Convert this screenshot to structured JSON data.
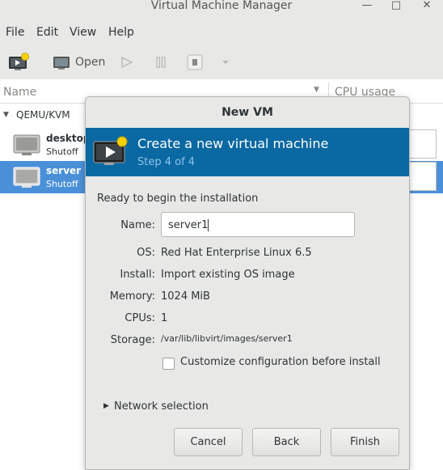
{
  "window": {
    "title": "Virtual Machine Manager",
    "minimize": "—",
    "maximize": "□",
    "close": "✕"
  },
  "menubar": {
    "items": [
      "File",
      "Edit",
      "View",
      "Help"
    ]
  },
  "toolbar": {
    "open_label": "Open"
  },
  "columns": {
    "name": "Name",
    "cpu": "CPU usage"
  },
  "tree": {
    "group": "QEMU/KVM",
    "vms": [
      {
        "name": "desktop",
        "state": "Shutoff"
      },
      {
        "name": "server",
        "state": "Shutoff"
      }
    ]
  },
  "dialog": {
    "title": "New VM",
    "banner_title": "Create a new virtual machine",
    "banner_step": "Step 4 of 4",
    "ready_text": "Ready to begin the installation",
    "fields": {
      "name_label": "Name:",
      "name_value": "server1",
      "os_label": "OS:",
      "os_value": "Red Hat Enterprise Linux 6.5",
      "install_label": "Install:",
      "install_value": "Import existing OS image",
      "memory_label": "Memory:",
      "memory_value": "1024 MiB",
      "cpus_label": "CPUs:",
      "cpus_value": "1",
      "storage_label": "Storage:",
      "storage_value": "/var/lib/libvirt/images/server1"
    },
    "customize_label": "Customize configuration before install",
    "customize_checked": false,
    "network_label": "Network selection",
    "buttons": {
      "cancel": "Cancel",
      "back": "Back",
      "finish": "Finish"
    }
  },
  "colors": {
    "accent": "#4a90d9",
    "banner": "#0a68a2",
    "banner_step": "#8ec3ec",
    "chrome": "#e8e8e7"
  }
}
